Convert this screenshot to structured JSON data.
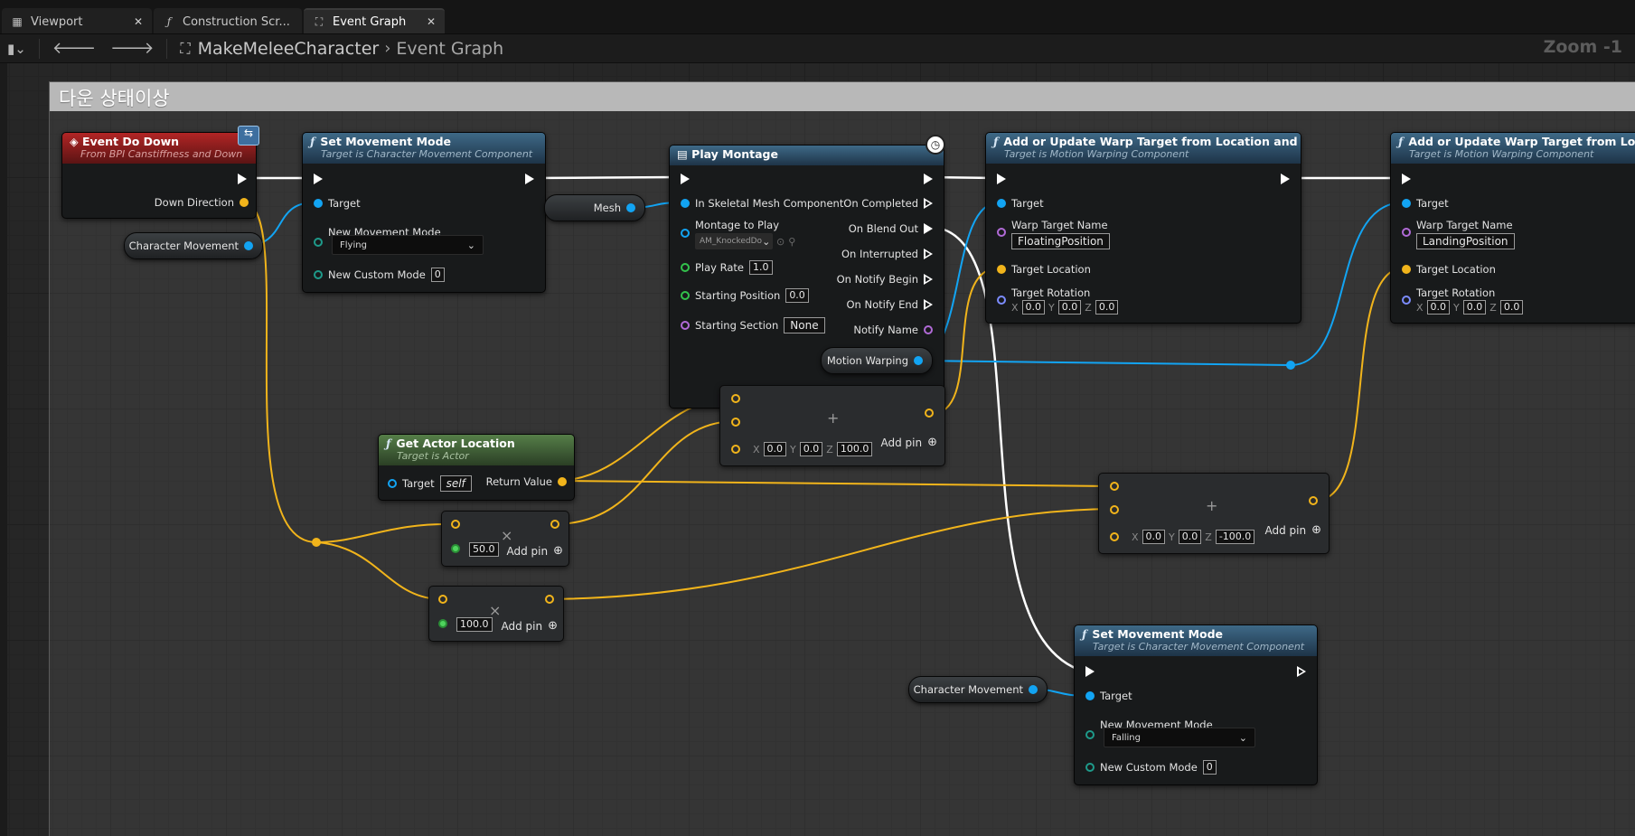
{
  "tabs": [
    {
      "label": "Viewport",
      "icon": "grid-icon",
      "active": false
    },
    {
      "label": "Construction Scr...",
      "icon": "function-icon",
      "active": false
    },
    {
      "label": "Event Graph",
      "icon": "graph-icon",
      "active": true
    }
  ],
  "breadcrumb": {
    "blueprint": "MakeMeleeCharacter",
    "graph": "Event Graph"
  },
  "zoom": "Zoom -1",
  "comment": {
    "title": "다운 상태이상"
  },
  "nodes": {
    "event_do_down": {
      "title": "Event Do Down",
      "subtitle": "From BPI Canstiffness and Down",
      "pin_down_direction": "Down Direction"
    },
    "set_movement_1": {
      "title": "Set Movement Mode",
      "subtitle": "Target is Character Movement Component",
      "pin_target": "Target",
      "pin_new_mode": "New Movement Mode",
      "mode_value": "Flying",
      "pin_custom_mode": "New Custom Mode",
      "custom_mode_value": "0"
    },
    "play_montage": {
      "title": "Play Montage",
      "pin_skeletal": "In Skeletal Mesh Component",
      "pin_montage": "Montage to Play",
      "montage_value": "AM_KnockedDo",
      "pin_rate": "Play Rate",
      "rate_value": "1.0",
      "pin_start_pos": "Starting Position",
      "start_pos_value": "0.0",
      "pin_start_section": "Starting Section",
      "start_section_value": "None",
      "out_completed": "On Completed",
      "out_blend_out": "On Blend Out",
      "out_interrupted": "On Interrupted",
      "out_notify_begin": "On Notify Begin",
      "out_notify_end": "On Notify End",
      "out_notify_name": "Notify Name"
    },
    "warp_1": {
      "title": "Add or Update Warp Target from Location and Rotation",
      "subtitle": "Target is Motion Warping Component",
      "pin_target": "Target",
      "pin_warp_name": "Warp Target Name",
      "warp_name_value": "FloatingPosition",
      "pin_location": "Target Location",
      "pin_rotation": "Target Rotation",
      "rot_x": "0.0",
      "rot_y": "0.0",
      "rot_z": "0.0"
    },
    "warp_2": {
      "title": "Add or Update Warp Target from Location and Rotation",
      "subtitle": "Target is Motion Warping Component",
      "pin_target": "Target",
      "pin_warp_name": "Warp Target Name",
      "warp_name_value": "LandingPosition",
      "pin_location": "Target Location",
      "pin_rotation": "Target Rotation",
      "rot_x": "0.0",
      "rot_y": "0.0",
      "rot_z": "0.0"
    },
    "get_actor_location": {
      "title": "Get Actor Location",
      "subtitle": "Target is Actor",
      "pin_target": "Target",
      "target_value": "self",
      "pin_return": "Return Value"
    },
    "set_movement_2": {
      "title": "Set Movement Mode",
      "subtitle": "Target is Character Movement Component",
      "pin_target": "Target",
      "pin_new_mode": "New Movement Mode",
      "mode_value": "Falling",
      "pin_custom_mode": "New Custom Mode",
      "custom_mode_value": "0"
    },
    "add_1": {
      "x": "0.0",
      "y": "0.0",
      "z": "100.0",
      "add_pin": "Add pin"
    },
    "add_2": {
      "x": "0.0",
      "y": "0.0",
      "z": "-100.0",
      "add_pin": "Add pin"
    },
    "mul_1": {
      "value": "50.0",
      "add_pin": "Add pin"
    },
    "mul_2": {
      "value": "100.0",
      "add_pin": "Add pin"
    }
  },
  "vars": {
    "char_movement_1": "Character Movement",
    "mesh": "Mesh",
    "motion_warping": "Motion Warping",
    "char_movement_2": "Character Movement"
  },
  "axes": {
    "x": "X",
    "y": "Y",
    "z": "Z"
  },
  "colors": {
    "exec": "#ffffff",
    "object": "#12a4f3",
    "vector": "#f1b41b",
    "float": "#33c24c",
    "name": "#b06ad6"
  }
}
